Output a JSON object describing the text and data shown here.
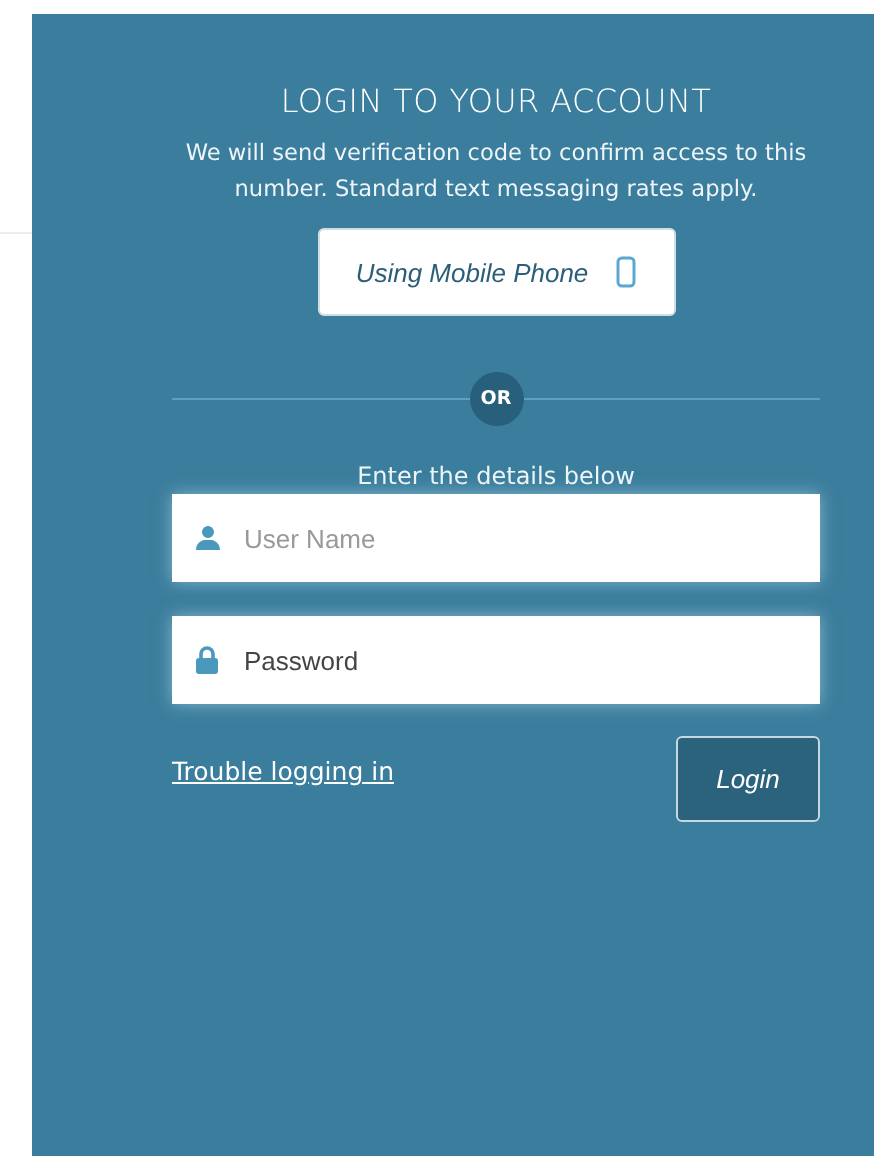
{
  "title": "LOGIN TO YOUR ACCOUNT",
  "description": "We will send verification code to confirm access to this number. Standard text messaging rates apply.",
  "mobile_button": {
    "label": "Using Mobile Phone"
  },
  "divider": {
    "label": "OR"
  },
  "instructions": "Enter the details below",
  "fields": [
    {
      "kind": "user",
      "placeholder": "User Name"
    },
    {
      "kind": "password",
      "placeholder": "Password"
    }
  ],
  "trouble_link": "Trouble logging in",
  "login_button": "Login"
}
